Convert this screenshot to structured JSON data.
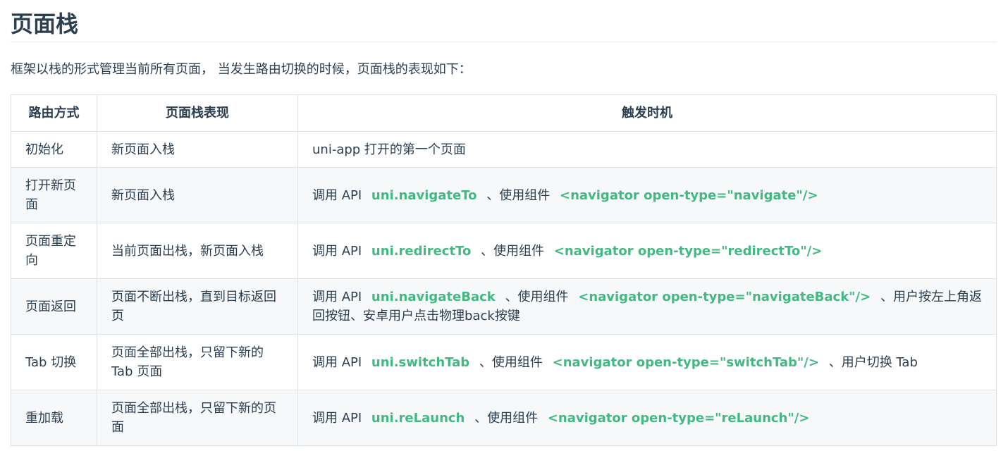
{
  "title": "页面栈",
  "intro": "框架以栈的形式管理当前所有页面， 当发生路由切换的时候，页面栈的表现如下：",
  "table": {
    "headers": [
      "路由方式",
      "页面栈表现",
      "触发时机"
    ],
    "rows": [
      {
        "method": "初始化",
        "stack": "新页面入栈",
        "trigger": [
          {
            "text": "uni-app 打开的第一个页面"
          }
        ]
      },
      {
        "method": "打开新页面",
        "stack": "新页面入栈",
        "trigger": [
          {
            "text": "调用 API "
          },
          {
            "code": "uni.navigateTo"
          },
          {
            "text": " 、使用组件 "
          },
          {
            "code": "<navigator open-type=\"navigate\"/>"
          }
        ]
      },
      {
        "method": "页面重定向",
        "stack": "当前页面出栈，新页面入栈",
        "trigger": [
          {
            "text": "调用 API "
          },
          {
            "code": "uni.redirectTo"
          },
          {
            "text": " 、使用组件 "
          },
          {
            "code": "<navigator open-type=\"redirectTo\"/>"
          }
        ]
      },
      {
        "method": "页面返回",
        "stack": "页面不断出栈，直到目标返回页",
        "trigger": [
          {
            "text": "调用 API "
          },
          {
            "code": "uni.navigateBack"
          },
          {
            "text": " 、使用组件 "
          },
          {
            "code": "<navigator open-type=\"navigateBack\"/>"
          },
          {
            "text": " 、用户按左上角返回按钮、安卓用户点击物理back按键"
          }
        ]
      },
      {
        "method": "Tab 切换",
        "stack": "页面全部出栈，只留下新的 Tab 页面",
        "trigger": [
          {
            "text": "调用 API "
          },
          {
            "code": "uni.switchTab"
          },
          {
            "text": " 、使用组件 "
          },
          {
            "code": "<navigator open-type=\"switchTab\"/>"
          },
          {
            "text": " 、用户切换 Tab"
          }
        ]
      },
      {
        "method": "重加载",
        "stack": "页面全部出栈，只留下新的页面",
        "trigger": [
          {
            "text": "调用 API "
          },
          {
            "code": "uni.reLaunch"
          },
          {
            "text": " 、使用组件 "
          },
          {
            "code": "<navigator open-type=\"reLaunch\"/>"
          }
        ]
      }
    ]
  },
  "colors": {
    "text": "#2c3e50",
    "code": "#42b983",
    "stripe": "#f6f8fa",
    "border": "#dfe2e5"
  }
}
